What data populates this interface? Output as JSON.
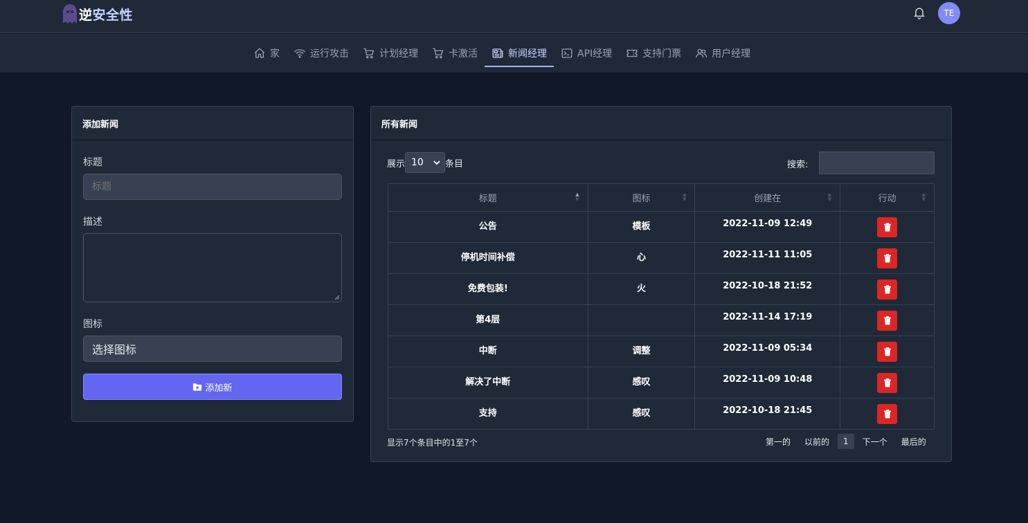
{
  "header": {
    "brand_part1": "逆",
    "brand_part2": "安全性",
    "avatar_initials": "TE"
  },
  "nav": [
    {
      "label": "家",
      "icon": "home-icon"
    },
    {
      "label": "运行攻击",
      "icon": "wifi-icon"
    },
    {
      "label": "计划经理",
      "icon": "cart-icon"
    },
    {
      "label": "卡激活",
      "icon": "cart-icon"
    },
    {
      "label": "新闻经理",
      "icon": "newspaper-icon",
      "active": true
    },
    {
      "label": "API经理",
      "icon": "terminal-icon"
    },
    {
      "label": "支持门票",
      "icon": "ticket-icon"
    },
    {
      "label": "用户经理",
      "icon": "users-icon"
    }
  ],
  "add_form": {
    "title": "添加新闻",
    "title_label": "标题",
    "title_placeholder": "标题",
    "desc_label": "描述",
    "icon_label": "图标",
    "icon_select_value": "选择图标",
    "submit_label": "添加新"
  },
  "news_table": {
    "title": "所有新闻",
    "show_label": "展示",
    "page_length": "10",
    "entries_label": "条目",
    "search_label": "搜索:",
    "columns": [
      "标题",
      "图标",
      "创建在",
      "行动"
    ],
    "rows": [
      {
        "title": "公告",
        "icon": "模板",
        "created": "2022-11-09 12:49"
      },
      {
        "title": "停机时间补偿",
        "icon": "心",
        "created": "2022-11-11 11:05"
      },
      {
        "title": "免费包装!",
        "icon": "火",
        "created": "2022-10-18 21:52"
      },
      {
        "title": "第4层",
        "icon": "",
        "created": "2022-11-14 17:19"
      },
      {
        "title": "中断",
        "icon": "调整",
        "created": "2022-11-09 05:34"
      },
      {
        "title": "解决了中断",
        "icon": "感叹",
        "created": "2022-11-09 10:48"
      },
      {
        "title": "支持",
        "icon": "感叹",
        "created": "2022-10-18 21:45"
      }
    ],
    "info": "显示7个条目中的1至7个",
    "pager": {
      "first": "第一的",
      "prev": "以前的",
      "current": "1",
      "next": "下一个",
      "last": "最后的"
    }
  },
  "colors": {
    "background": "#111827",
    "panel": "#1f2937",
    "accent": "#6366f1",
    "danger": "#dc2626"
  }
}
